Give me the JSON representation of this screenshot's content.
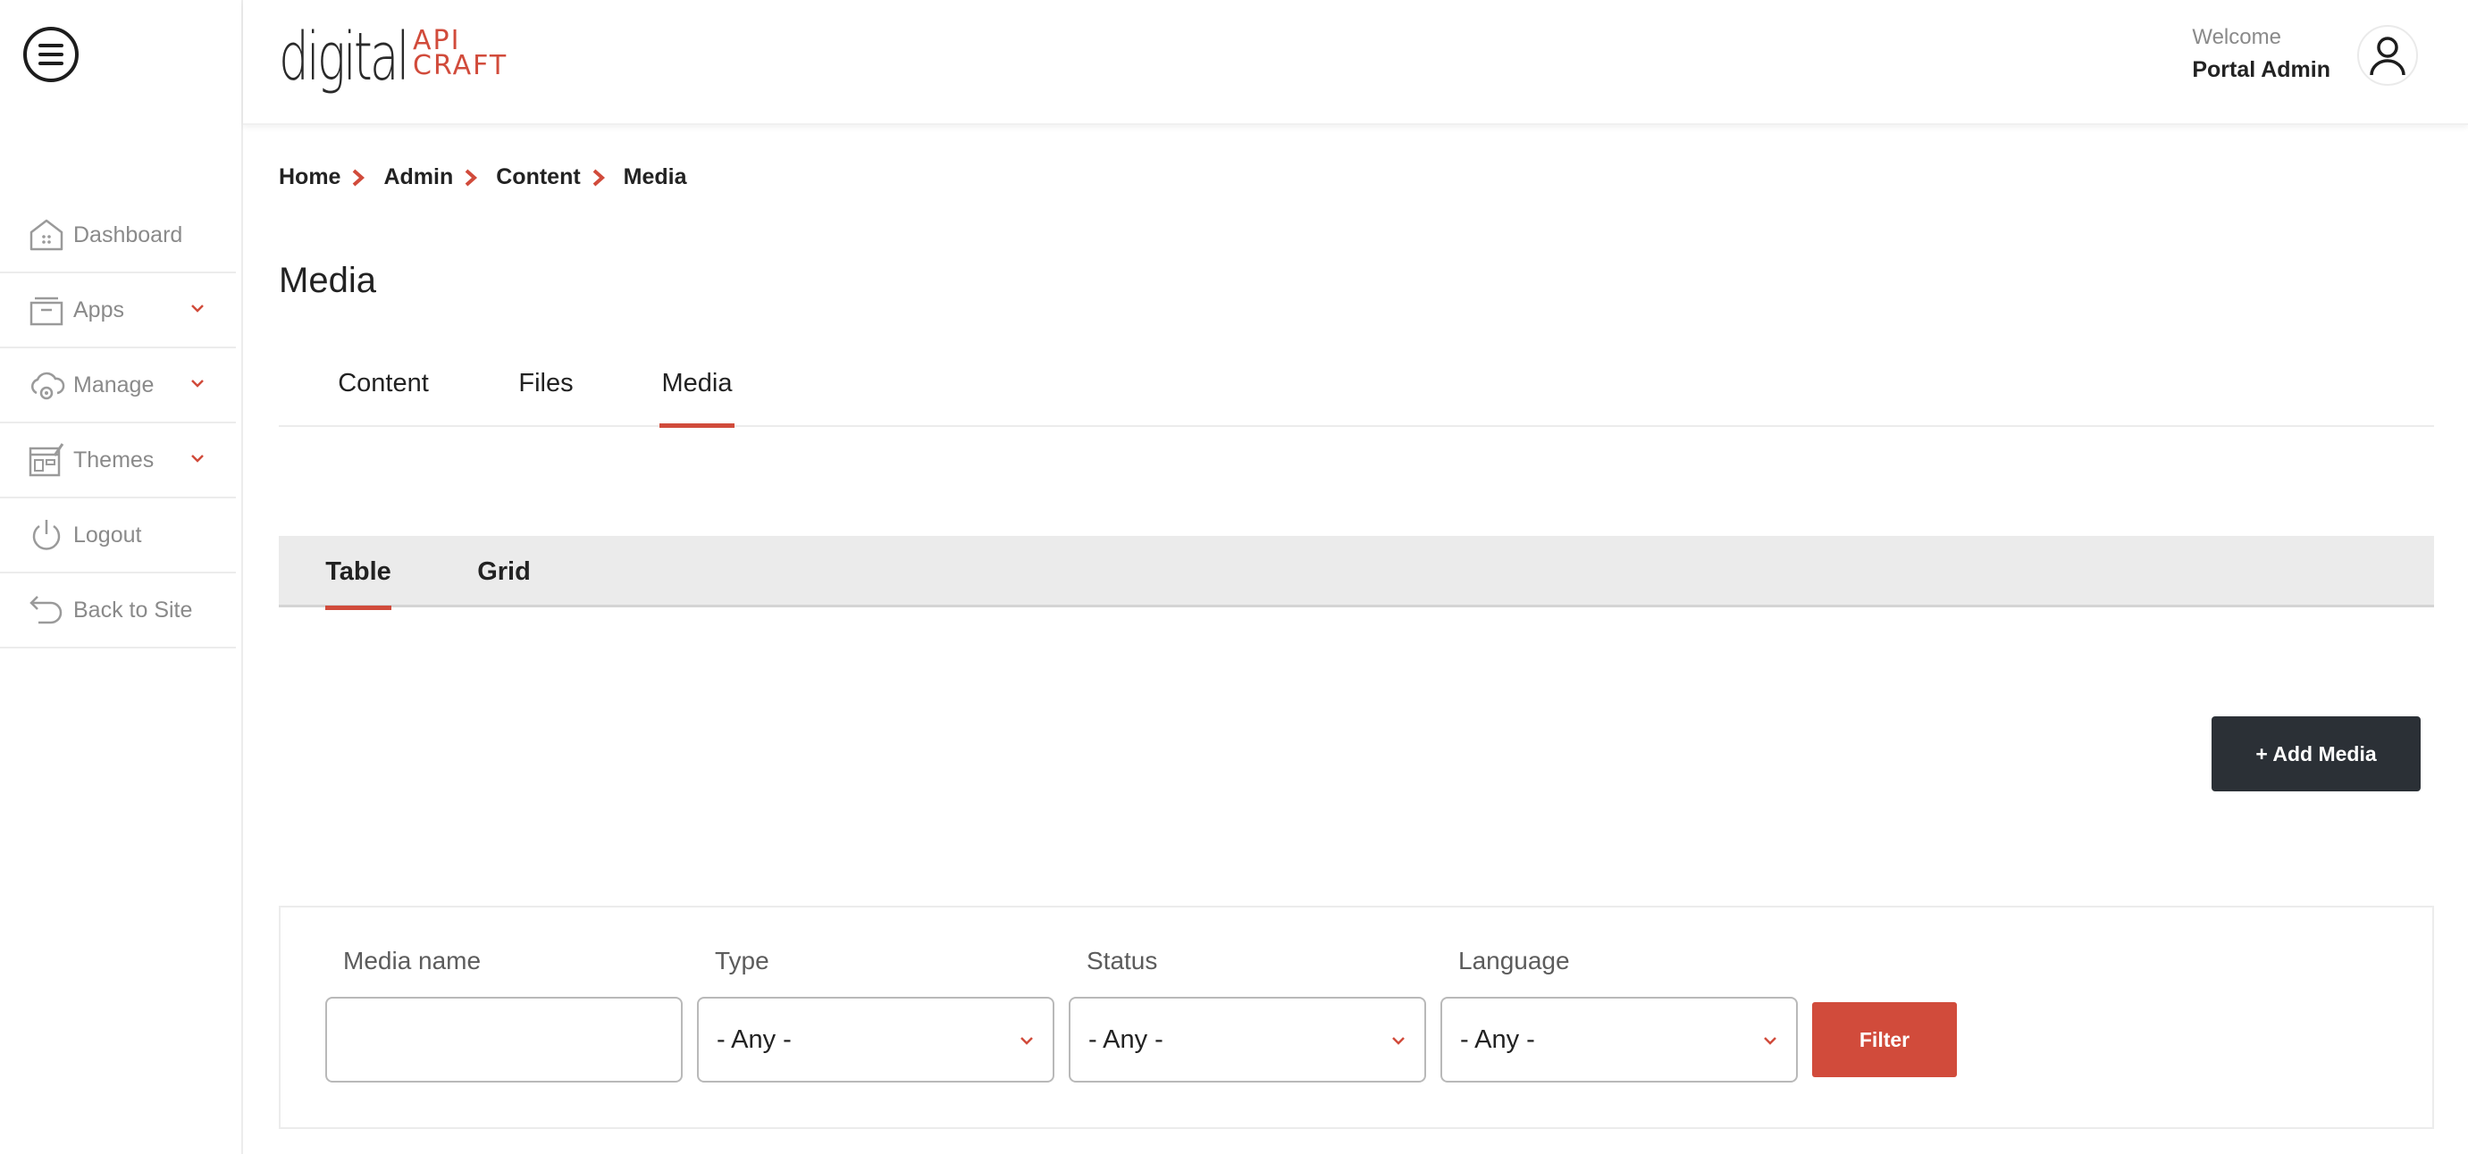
{
  "brand": {
    "wordmark": "digital",
    "sub_line1": "API",
    "sub_line2": "CRAFT",
    "accent_color": "#d14b3b"
  },
  "header": {
    "welcome": "Welcome",
    "user_name": "Portal Admin"
  },
  "sidebar": {
    "items": [
      {
        "label": "Dashboard",
        "icon": "home-icon",
        "has_dropdown": false
      },
      {
        "label": "Apps",
        "icon": "apps-icon",
        "has_dropdown": true
      },
      {
        "label": "Manage",
        "icon": "cloud-gear-icon",
        "has_dropdown": true
      },
      {
        "label": "Themes",
        "icon": "themes-icon",
        "has_dropdown": true
      },
      {
        "label": "Logout",
        "icon": "power-icon",
        "has_dropdown": false
      },
      {
        "label": "Back to Site",
        "icon": "back-arrow-icon",
        "has_dropdown": false
      }
    ]
  },
  "breadcrumb": [
    "Home",
    "Admin",
    "Content",
    "Media"
  ],
  "page_title": "Media",
  "tabs": [
    {
      "label": "Content",
      "active": false
    },
    {
      "label": "Files",
      "active": false
    },
    {
      "label": "Media",
      "active": true
    }
  ],
  "view_tabs": [
    {
      "label": "Table",
      "active": true
    },
    {
      "label": "Grid",
      "active": false
    }
  ],
  "add_button": "+ Add Media",
  "filters": {
    "media_name_label": "Media name",
    "media_name_value": "",
    "type_label": "Type",
    "type_value": "- Any -",
    "status_label": "Status",
    "status_value": "- Any -",
    "language_label": "Language",
    "language_value": "- Any -",
    "submit": "Filter"
  }
}
